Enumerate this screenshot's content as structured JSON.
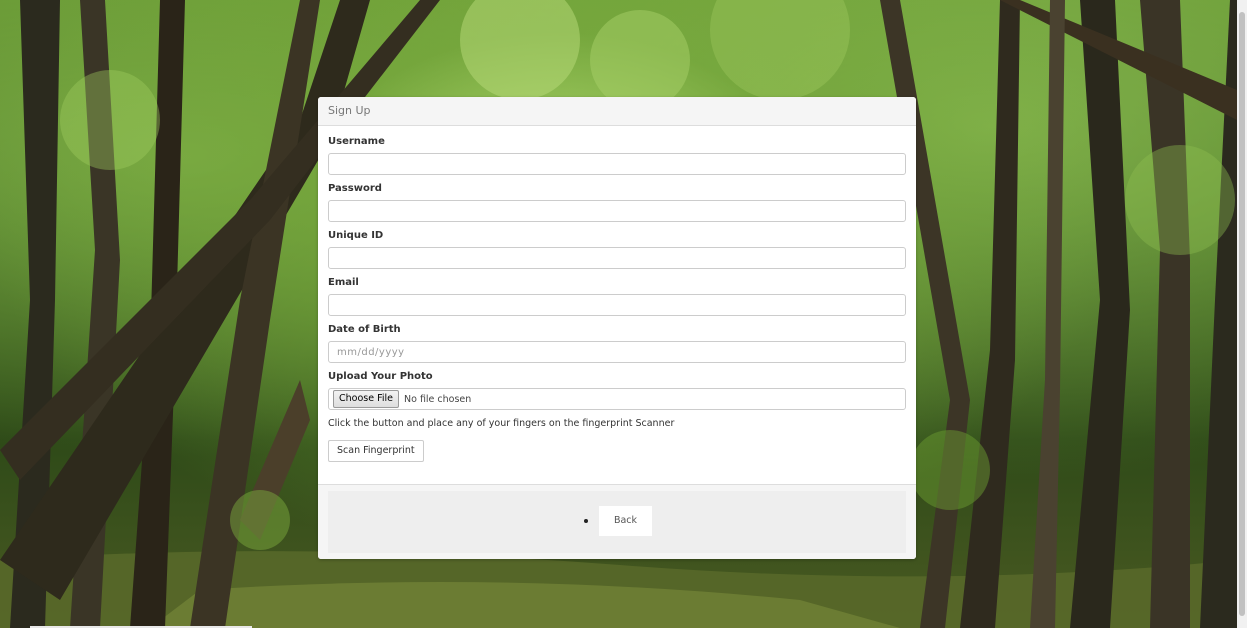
{
  "panel": {
    "heading": "Sign Up"
  },
  "form": {
    "username": {
      "label": "Username",
      "value": ""
    },
    "password": {
      "label": "Password",
      "value": ""
    },
    "unique_id": {
      "label": "Unique ID",
      "value": ""
    },
    "email": {
      "label": "Email",
      "value": ""
    },
    "dob": {
      "label": "Date of Birth",
      "placeholder": "mm/dd/yyyy"
    },
    "photo": {
      "label": "Upload Your Photo",
      "button": "Choose File",
      "status": "No file chosen"
    },
    "fingerprint_hint": "Click the button and place any of your fingers on the fingerprint Scanner",
    "scan_button": "Scan Fingerprint"
  },
  "footer": {
    "back_label": "Back"
  }
}
